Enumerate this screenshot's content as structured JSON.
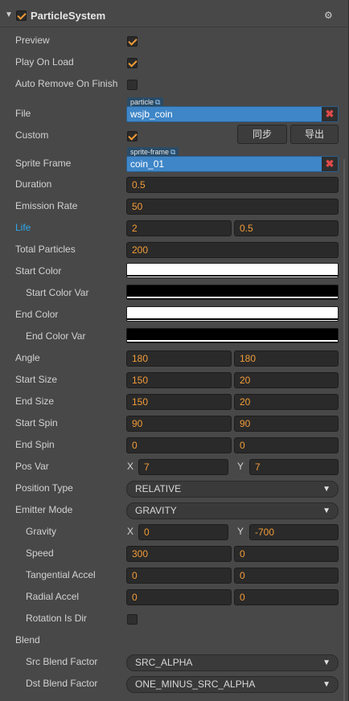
{
  "component": {
    "title": "ParticleSystem",
    "enabled": true
  },
  "preview": {
    "label": "Preview",
    "checked": true
  },
  "play_on_load": {
    "label": "Play On Load",
    "checked": true
  },
  "auto_remove": {
    "label": "Auto Remove On Finish",
    "checked": false
  },
  "file": {
    "label": "File",
    "asset_type": "particle",
    "value": "wsjb_coin"
  },
  "custom": {
    "label": "Custom",
    "checked": true,
    "sync_label": "同步",
    "export_label": "导出"
  },
  "sprite_frame": {
    "label": "Sprite Frame",
    "asset_type": "sprite-frame",
    "value": "coin_01"
  },
  "duration": {
    "label": "Duration",
    "value": "0.5"
  },
  "emission_rate": {
    "label": "Emission Rate",
    "value": "50"
  },
  "life": {
    "label": "Life",
    "value": "2",
    "var": "0.5"
  },
  "total_particles": {
    "label": "Total Particles",
    "value": "200"
  },
  "start_color": {
    "label": "Start Color",
    "color": "#ffffff"
  },
  "start_color_var": {
    "label": "Start Color Var",
    "color": "#000000"
  },
  "end_color": {
    "label": "End Color",
    "color": "#ffffff"
  },
  "end_color_var": {
    "label": "End Color Var",
    "color": "#000000"
  },
  "angle": {
    "label": "Angle",
    "value": "180",
    "var": "180"
  },
  "start_size": {
    "label": "Start Size",
    "value": "150",
    "var": "20"
  },
  "end_size": {
    "label": "End Size",
    "value": "150",
    "var": "20"
  },
  "start_spin": {
    "label": "Start Spin",
    "value": "90",
    "var": "90"
  },
  "end_spin": {
    "label": "End Spin",
    "value": "0",
    "var": "0"
  },
  "pos_var": {
    "label": "Pos Var",
    "x_label": "X",
    "x": "7",
    "y_label": "Y",
    "y": "7"
  },
  "position_type": {
    "label": "Position Type",
    "value": "RELATIVE"
  },
  "emitter_mode": {
    "label": "Emitter Mode",
    "value": "GRAVITY"
  },
  "gravity": {
    "label": "Gravity",
    "x_label": "X",
    "x": "0",
    "y_label": "Y",
    "y": "-700"
  },
  "speed": {
    "label": "Speed",
    "value": "300",
    "var": "0"
  },
  "tangential_accel": {
    "label": "Tangential Accel",
    "value": "0",
    "var": "0"
  },
  "radial_accel": {
    "label": "Radial Accel",
    "value": "0",
    "var": "0"
  },
  "rotation_is_dir": {
    "label": "Rotation Is Dir",
    "checked": false
  },
  "blend": {
    "label": "Blend"
  },
  "src_blend": {
    "label": "Src Blend Factor",
    "value": "SRC_ALPHA"
  },
  "dst_blend": {
    "label": "Dst Blend Factor",
    "value": "ONE_MINUS_SRC_ALPHA"
  },
  "colors": {
    "background": "#484848",
    "accent": "#f29c38",
    "highlight": "#2fa6ec",
    "asset": "#3e86c8"
  }
}
